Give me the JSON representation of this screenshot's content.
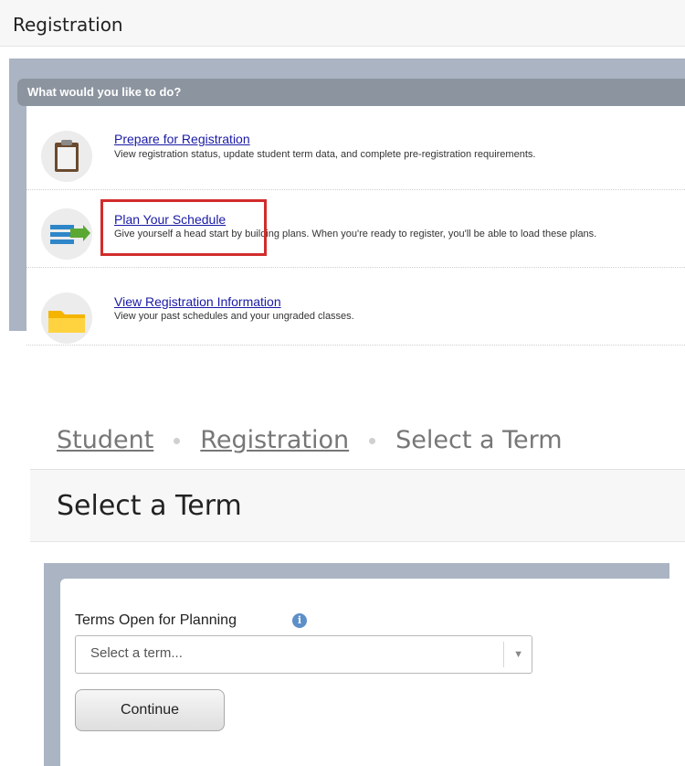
{
  "registration_panel": {
    "header_title": "Registration",
    "section_heading": "What would you like to do?",
    "items": [
      {
        "link": "Prepare for Registration",
        "description": "View registration status, update student term data, and complete pre-registration requirements.",
        "icon": "clipboard-icon"
      },
      {
        "link": "Plan Your Schedule",
        "description": "Give yourself a head start by building plans. When you're ready to register, you'll be able to load these plans.",
        "icon": "plan-list-icon"
      },
      {
        "link": "View Registration Information",
        "description": "View your past schedules and your ungraded classes.",
        "icon": "folder-icon"
      }
    ],
    "highlight_color": "#d12c2c"
  },
  "term_panel": {
    "breadcrumb": [
      "Student",
      "Registration",
      "Select a Term"
    ],
    "page_title": "Select a Term",
    "field_label": "Terms Open for Planning",
    "info_icon": "info-icon",
    "select_placeholder": "Select a term...",
    "continue_label": "Continue"
  }
}
